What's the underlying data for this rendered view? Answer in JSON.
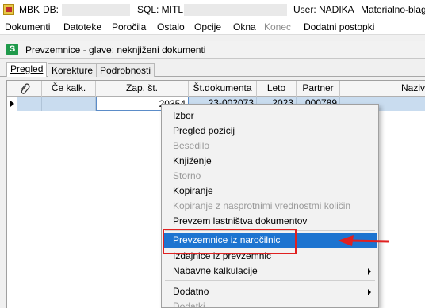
{
  "titlebar": {
    "app": "MBK",
    "db_label": "DB:",
    "sql_label": "SQL: MITL",
    "user": "User: NADIKA",
    "module": "Materialno-blag"
  },
  "menubar": {
    "items": [
      "Dokumenti",
      "Datoteke",
      "Poročila",
      "Ostalo",
      "Opcije",
      "Okna",
      "Konec",
      "Dodatni postopki"
    ]
  },
  "window": {
    "icon": "S",
    "title": "Prevzemnice - glave: neknjiženi dokumenti"
  },
  "tabs": [
    "Pregled",
    "Korekture",
    "Podrobnosti"
  ],
  "grid": {
    "columns": [
      "",
      "Če kalk.",
      "Zap. št.",
      "Št.dokumenta",
      "Leto",
      "Partner",
      "Naziv"
    ],
    "row": {
      "zap_st": "20354",
      "st_dokumenta": "23-002073",
      "leto": "2023",
      "partner": "000789"
    }
  },
  "context_menu": {
    "items": [
      {
        "label": "Izbor"
      },
      {
        "label": "Pregled pozicij"
      },
      {
        "label": "Besedilo"
      },
      {
        "label": "Knjiženje"
      },
      {
        "label": "Storno"
      },
      {
        "label": "Kopiranje"
      },
      {
        "label": "Kopiranje z nasprotnimi vrednostmi količin"
      },
      {
        "label": "Prevzem lastništva dokumentov"
      },
      {
        "label": "Prevzemnice iz naročilnic"
      },
      {
        "label": "Izdajnice iz prevzemnic"
      },
      {
        "label": "Nabavne kalkulacije"
      },
      {
        "label": "Dodatno"
      },
      {
        "label": "Dodatki"
      }
    ]
  },
  "colors": {
    "highlight": "#1d74d0",
    "annotation": "#e02020",
    "selected_row": "#c9dcef"
  }
}
